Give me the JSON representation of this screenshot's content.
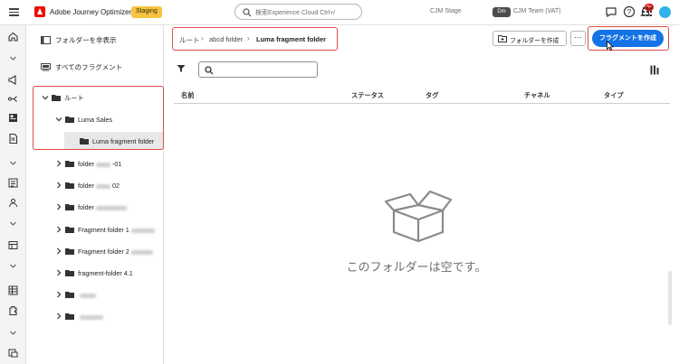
{
  "app": {
    "title": "Adobe Journey Optimizer",
    "env_badge": "Staging"
  },
  "search": {
    "placeholder": "検索Experience Cloud Ctrl+/"
  },
  "org": {
    "name": "CJM Stage",
    "team_badge": "Dm",
    "team_name": "CJM Team (VAT)"
  },
  "notifications": {
    "count": "9+"
  },
  "sidebar": {
    "hide_folders_label": "フォルダーを非表示",
    "all_fragments_label": "すべてのフラグメント",
    "tree": [
      {
        "label": "ルート",
        "level": 0,
        "expanded": true
      },
      {
        "label": "Luma Sales",
        "level": 1,
        "expanded": true
      },
      {
        "label": "Luma fragment folder",
        "level": 2,
        "selected": true
      },
      {
        "label": "folder",
        "suffix": "-01",
        "level": 0
      },
      {
        "label": "folder",
        "suffix": "02",
        "level": 0
      },
      {
        "label": "folder",
        "suffix": "",
        "level": 0
      },
      {
        "label": "Fragment folder 1",
        "level": 0
      },
      {
        "label": "Fragment folder 2",
        "level": 0
      },
      {
        "label": "fragment-folder 4.1",
        "level": 0
      },
      {
        "label": "",
        "level": 0
      },
      {
        "label": "",
        "level": 0
      }
    ]
  },
  "breadcrumb": {
    "root": "ルート",
    "parent": "abcd folder",
    "current": "Luma fragment folder"
  },
  "toolbar": {
    "create_folder_label": "フォルダーを作成",
    "more_label": "···",
    "create_fragment_label": "フラグメントを作成"
  },
  "table": {
    "columns": [
      "名前",
      "ステータス",
      "タグ",
      "チャネル",
      "タイプ"
    ]
  },
  "empty": {
    "message": "このフォルダーは空です。"
  },
  "colors": {
    "accent": "#1473e6",
    "badge": "#f6c343",
    "highlight": "#e04b4b"
  }
}
